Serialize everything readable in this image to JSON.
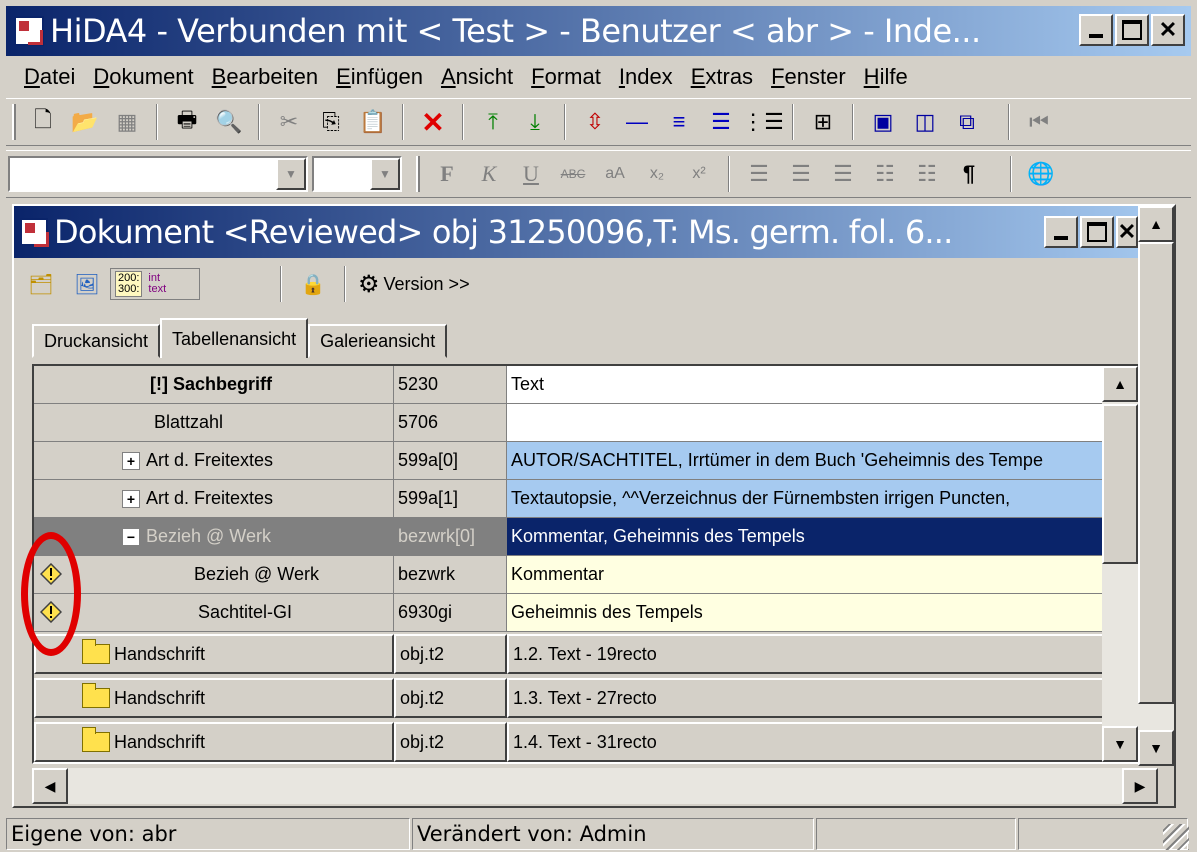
{
  "window": {
    "title": "HiDA4 - Verbunden mit < Test > - Benutzer < abr > - Inde..."
  },
  "menu": [
    "Datei",
    "Dokument",
    "Bearbeiten",
    "Einfügen",
    "Ansicht",
    "Format",
    "Index",
    "Extras",
    "Fenster",
    "Hilfe"
  ],
  "doc": {
    "title": "Dokument <Reviewed> obj 31250096,T: Ms. germ. fol. 6...",
    "toolbar": {
      "nums_top": "200:",
      "nums_bottom": "300:",
      "label_top": "int",
      "label_bottom": "text",
      "version_label": "Version >>"
    },
    "tabs": [
      "Druckansicht",
      "Tabellenansicht",
      "Galerieansicht"
    ],
    "active_tab": "Tabellenansicht",
    "rows": [
      {
        "name": "[!] Sachbegriff",
        "code": "5230",
        "value": "Text"
      },
      {
        "name": "Blattzahl",
        "code": "5706",
        "value": ""
      },
      {
        "name": "Art d. Freitextes",
        "code": "599a[0]",
        "value": "AUTOR/SACHTITEL, Irrtümer in dem Buch 'Geheimnis des Tempe"
      },
      {
        "name": "Art d. Freitextes",
        "code": "599a[1]",
        "value": "Textautopsie, ^^Verzeichnus der Fürnembsten irrigen Puncten,"
      },
      {
        "name": "Bezieh @ Werk",
        "code": "bezwrk[0]",
        "value": "Kommentar, Geheimnis des Tempels"
      },
      {
        "name": "Bezieh @ Werk",
        "code": "bezwrk",
        "value": "Kommentar"
      },
      {
        "name": "Sachtitel-GI",
        "code": "6930gi",
        "value": "Geheimnis des Tempels"
      },
      {
        "name": "Handschrift",
        "code": "obj.t2",
        "value": "1.2. Text - 19recto"
      },
      {
        "name": "Handschrift",
        "code": "obj.t2",
        "value": "1.3. Text - 27recto"
      },
      {
        "name": "Handschrift",
        "code": "obj.t2",
        "value": "1.4. Text - 31recto"
      }
    ]
  },
  "status": {
    "owner": "Eigene von: abr",
    "changed": "Verändert von: Admin"
  },
  "colors": {
    "title_gradient_start": "#0a246a",
    "title_gradient_end": "#a6caf0",
    "selected_row": "#0a246a",
    "highlight_value": "#a6caf0",
    "annotation": "#e00000"
  }
}
